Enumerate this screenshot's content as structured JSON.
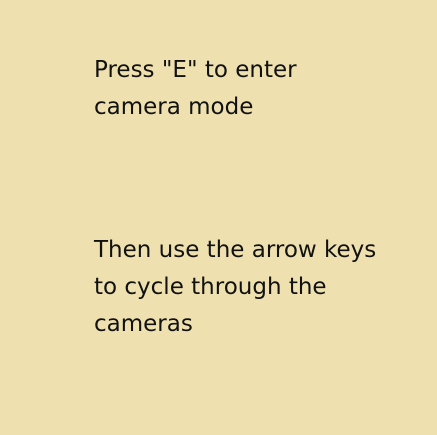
{
  "instructions": {
    "enter_camera": {
      "line1": "Press \"E\" to enter",
      "line2": "camera mode"
    },
    "cycle_cameras": {
      "line1": "Then use the arrow keys",
      "line2": "to cycle through the",
      "line3": "cameras"
    }
  },
  "colors": {
    "background": "#EFE1AF",
    "text": "#111111"
  }
}
